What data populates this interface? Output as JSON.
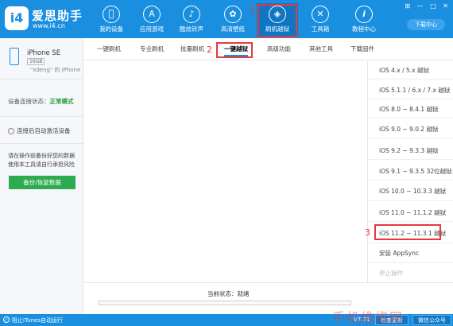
{
  "brand": {
    "name": "爱思助手",
    "url": "www.i4.cn",
    "logo_text": "i4"
  },
  "nav": [
    {
      "label": "我的设备",
      "icon": "apple-icon",
      "glyph": ""
    },
    {
      "label": "应用游戏",
      "icon": "appstore-icon",
      "glyph": "A"
    },
    {
      "label": "酷炫铃声",
      "icon": "bell-icon",
      "glyph": "♪"
    },
    {
      "label": "高清壁纸",
      "icon": "flower-icon",
      "glyph": "✿"
    },
    {
      "label": "刷机越狱",
      "icon": "dropbox-icon",
      "glyph": "◈"
    },
    {
      "label": "工具箱",
      "icon": "tools-icon",
      "glyph": "✕"
    },
    {
      "label": "教程中心",
      "icon": "info-icon",
      "glyph": "i"
    }
  ],
  "download_center": "下载中心",
  "window_controls": [
    "⊞",
    "—",
    "□",
    "✕"
  ],
  "device": {
    "name": "iPhone SE",
    "capacity": "16GB",
    "owner": "\"xdeng\" 的 iPhone"
  },
  "sidebar": {
    "status_label": "设备连接状态：",
    "status_value": "正常模式",
    "auto_activate": "连接后自动激活设备",
    "backup_note": "请在操作前备份好您的数据 使用本工具请自行承担风险",
    "backup_button": "备份/恢复数据"
  },
  "tabs": [
    "一键刷机",
    "专业刷机",
    "批量刷机",
    "一键越狱",
    "高级功能",
    "其他工具",
    "下载固件"
  ],
  "jailbreak_list": [
    "iOS 4.x / 5.x 越狱",
    "iOS 5.1.1 / 6.x / 7.x 越狱",
    "iOS 8.0 ~ 8.4.1 越狱",
    "iOS 9.0 ~ 9.0.2 越狱",
    "iOS 9.2 ~ 9.3.3 越狱",
    "iOS 9.1 ~ 9.3.5 32位越狱",
    "iOS 10.0 ~ 10.3.3 越狱",
    "iOS 11.0 ~ 11.1.2 越狱",
    "iOS 11.2 ~ 11.3.1 越狱",
    "安装 AppSync",
    "停止操作"
  ],
  "annotations": [
    "1",
    "2",
    "3"
  ],
  "status": {
    "text": "当前状态：就绪",
    "progress": 0
  },
  "footer": {
    "itunes": "阻止iTunes自动运行",
    "version": "V7.71",
    "check_update": "检查更新",
    "wechat": "微信公众号"
  },
  "watermark": "手机维修网"
}
